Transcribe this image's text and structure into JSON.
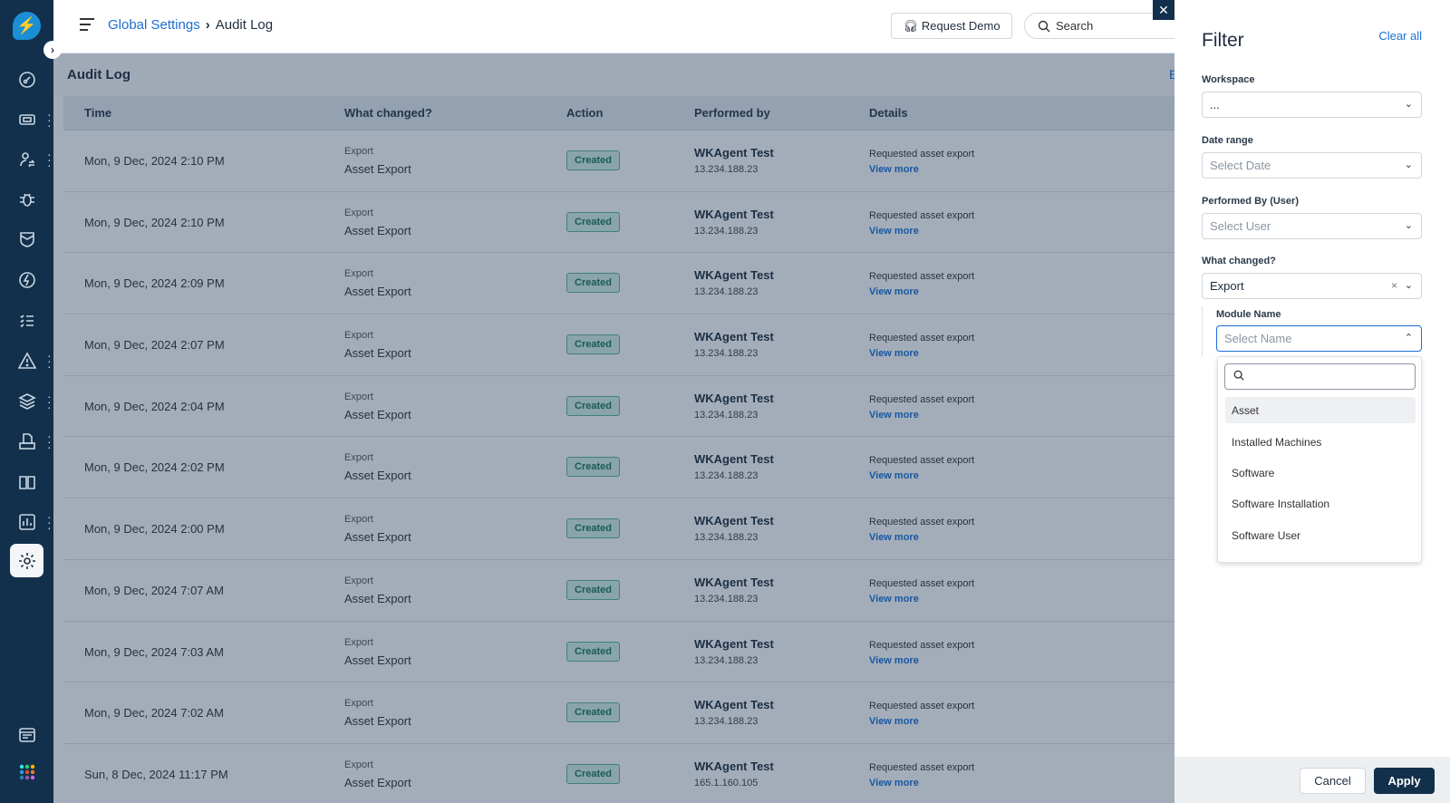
{
  "header": {
    "breadcrumb_parent": "Global Settings",
    "breadcrumb_separator": "›",
    "breadcrumb_current": "Audit Log",
    "request_demo": "Request Demo",
    "search_placeholder": "Search"
  },
  "sidebar": {
    "icons": [
      "dashboard-icon",
      "ticket-icon",
      "user-transfer-icon",
      "bug-icon",
      "shield-icon",
      "lightning-icon",
      "checklist-icon",
      "alert-icon",
      "layers-icon",
      "printer-icon",
      "book-icon",
      "chart-icon",
      "settings-icon",
      "browser-icon",
      "apps-grid-icon"
    ]
  },
  "page": {
    "title": "Audit Log",
    "export_label": "E"
  },
  "table": {
    "columns": [
      "Time",
      "What changed?",
      "Action",
      "Performed by",
      "Details"
    ],
    "rows": [
      {
        "time": "Mon, 9 Dec, 2024 2:10 PM",
        "module": "Export",
        "entity": "Asset Export",
        "action": "Created",
        "user": "WKAgent Test",
        "ip": "13.234.188.23",
        "details": "Requested asset export",
        "link": "View more"
      },
      {
        "time": "Mon, 9 Dec, 2024 2:10 PM",
        "module": "Export",
        "entity": "Asset Export",
        "action": "Created",
        "user": "WKAgent Test",
        "ip": "13.234.188.23",
        "details": "Requested asset export",
        "link": "View more"
      },
      {
        "time": "Mon, 9 Dec, 2024 2:09 PM",
        "module": "Export",
        "entity": "Asset Export",
        "action": "Created",
        "user": "WKAgent Test",
        "ip": "13.234.188.23",
        "details": "Requested asset export",
        "link": "View more"
      },
      {
        "time": "Mon, 9 Dec, 2024 2:07 PM",
        "module": "Export",
        "entity": "Asset Export",
        "action": "Created",
        "user": "WKAgent Test",
        "ip": "13.234.188.23",
        "details": "Requested asset export",
        "link": "View more"
      },
      {
        "time": "Mon, 9 Dec, 2024 2:04 PM",
        "module": "Export",
        "entity": "Asset Export",
        "action": "Created",
        "user": "WKAgent Test",
        "ip": "13.234.188.23",
        "details": "Requested asset export",
        "link": "View more"
      },
      {
        "time": "Mon, 9 Dec, 2024 2:02 PM",
        "module": "Export",
        "entity": "Asset Export",
        "action": "Created",
        "user": "WKAgent Test",
        "ip": "13.234.188.23",
        "details": "Requested asset export",
        "link": "View more"
      },
      {
        "time": "Mon, 9 Dec, 2024 2:00 PM",
        "module": "Export",
        "entity": "Asset Export",
        "action": "Created",
        "user": "WKAgent Test",
        "ip": "13.234.188.23",
        "details": "Requested asset export",
        "link": "View more"
      },
      {
        "time": "Mon, 9 Dec, 2024 7:07 AM",
        "module": "Export",
        "entity": "Asset Export",
        "action": "Created",
        "user": "WKAgent Test",
        "ip": "13.234.188.23",
        "details": "Requested asset export",
        "link": "View more"
      },
      {
        "time": "Mon, 9 Dec, 2024 7:03 AM",
        "module": "Export",
        "entity": "Asset Export",
        "action": "Created",
        "user": "WKAgent Test",
        "ip": "13.234.188.23",
        "details": "Requested asset export",
        "link": "View more"
      },
      {
        "time": "Mon, 9 Dec, 2024 7:02 AM",
        "module": "Export",
        "entity": "Asset Export",
        "action": "Created",
        "user": "WKAgent Test",
        "ip": "13.234.188.23",
        "details": "Requested asset export",
        "link": "View more"
      },
      {
        "time": "Sun, 8 Dec, 2024 11:17 PM",
        "module": "Export",
        "entity": "Asset Export",
        "action": "Created",
        "user": "WKAgent Test",
        "ip": "165.1.160.105",
        "details": "Requested asset export",
        "link": "View more"
      }
    ]
  },
  "filter": {
    "close": "✕",
    "title": "Filter",
    "clear_all": "Clear all",
    "workspace": {
      "label": "Workspace",
      "value": "..."
    },
    "date_range": {
      "label": "Date range",
      "placeholder": "Select Date"
    },
    "performed_by": {
      "label": "Performed By (User)",
      "placeholder": "Select User"
    },
    "what_changed": {
      "label": "What changed?",
      "value": "Export"
    },
    "module_name": {
      "label": "Module Name",
      "placeholder": "Select Name",
      "options": [
        "Asset",
        "Installed Machines",
        "Software",
        "Software Installation",
        "Software User"
      ],
      "highlighted": "Asset"
    },
    "cancel": "Cancel",
    "apply": "Apply"
  },
  "colors": {
    "sidebar": "#12304b",
    "accent": "#1a6fd6",
    "badge_green": "#1b7858"
  }
}
